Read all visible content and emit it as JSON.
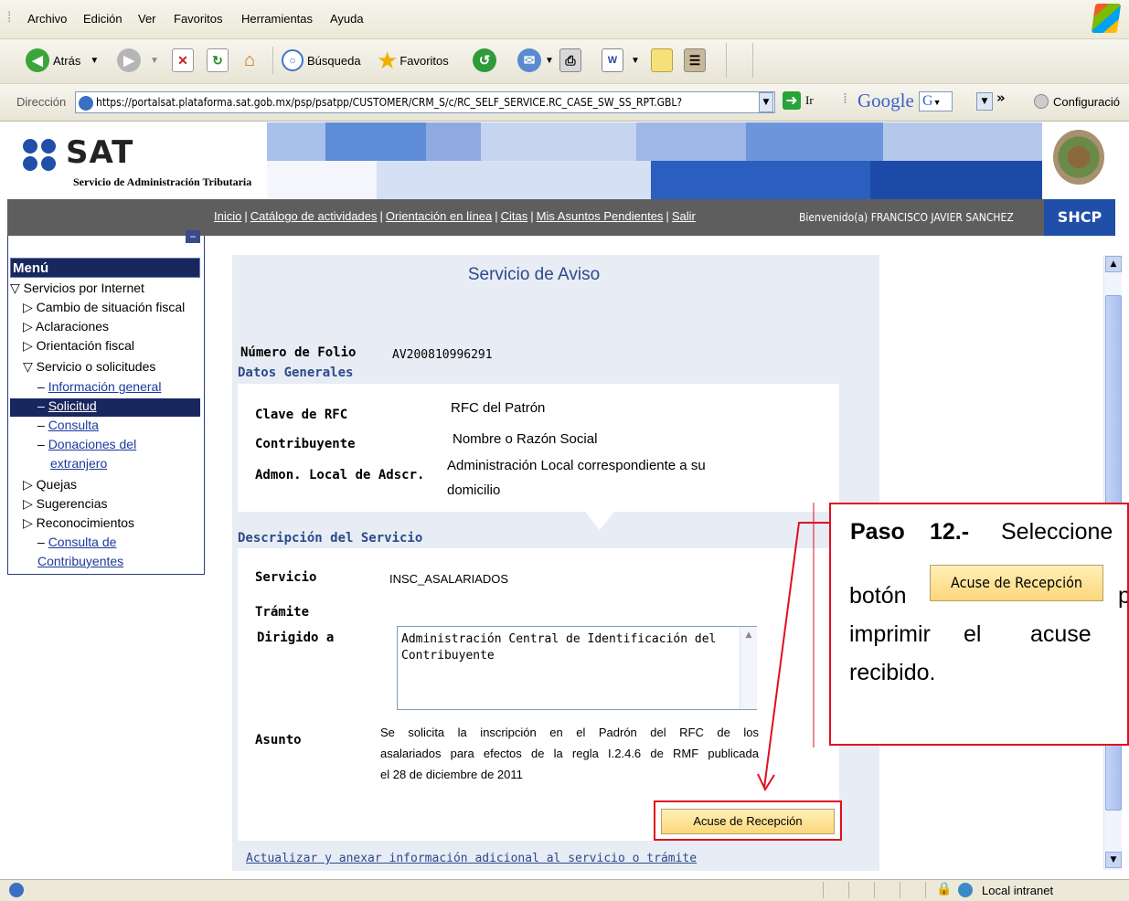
{
  "browser": {
    "menu": [
      "Archivo",
      "Edición",
      "Ver",
      "Favoritos",
      "Herramientas",
      "Ayuda"
    ],
    "toolbar": {
      "back": "Atrás",
      "search": "Búsqueda",
      "favorites": "Favoritos"
    },
    "address_label": "Dirección",
    "url": "https://portalsat.plataforma.sat.gob.mx/psp/psatpp/CUSTOMER/CRM_S/c/RC_SELF_SERVICE.RC_CASE_SW_SS_RPT.GBL?",
    "go_label": "Ir",
    "google_label": "Google",
    "google_g": "G",
    "config_label": "Configuració",
    "status_zone": "Local intranet"
  },
  "header": {
    "logo_text": "SAT",
    "logo_subtitle": "Servicio de Administración Tributaria",
    "nav_links": [
      "Inicio",
      "Catálogo de actividades",
      "Orientación en línea",
      "Citas",
      "Mis Asuntos Pendientes",
      "Salir"
    ],
    "welcome": "Bienvenido(a) FRANCISCO JAVIER SANCHEZ",
    "shcp": "SHCP"
  },
  "menu": {
    "title": "Menú",
    "items": [
      {
        "label": "Servicios por Internet",
        "type": "open"
      },
      {
        "label": "Cambio de situación fiscal",
        "type": "closed"
      },
      {
        "label": "Aclaraciones",
        "type": "closed"
      },
      {
        "label": "Orientación fiscal",
        "type": "closed"
      },
      {
        "label": "Servicio o solicitudes",
        "type": "open"
      },
      {
        "label": "Información general",
        "type": "link"
      },
      {
        "label": "Solicitud",
        "type": "selected"
      },
      {
        "label": "Consulta",
        "type": "link"
      },
      {
        "label": "Donaciones del",
        "type": "link"
      },
      {
        "label": "extranjero",
        "type": "link-cont"
      },
      {
        "label": "Quejas",
        "type": "closed"
      },
      {
        "label": "Sugerencias",
        "type": "closed"
      },
      {
        "label": "Reconocimientos",
        "type": "closed"
      },
      {
        "label": "Consulta de",
        "type": "link"
      },
      {
        "label": "Contribuyentes",
        "type": "link-cont"
      }
    ]
  },
  "form": {
    "title": "Servicio de Aviso",
    "folio_label": "Número de Folio",
    "folio_value": "AV200810996291",
    "section1": "Datos Generales",
    "rfc_label": "Clave de RFC",
    "rfc_value": "RFC del Patrón",
    "contrib_label": "Contribuyente",
    "contrib_value": "Nombre o Razón Social",
    "admon_label": "Admon. Local de Adscr.",
    "admon_value_1": "Administración Local  correspondiente a su",
    "admon_value_2": "domicilio",
    "section2": "Descripción del Servicio",
    "servicio_label": "Servicio",
    "servicio_value": "INSC_ASALARIADOS",
    "tramite_label": "Trámite",
    "dirigido_label": "Dirigido a",
    "dirigido_value": "Administración Central de Identificación del Contribuyente",
    "asunto_label": "Asunto",
    "asunto_lines": [
      "Se solicita la inscripción en el Padrón del RFC de los",
      "asalariados para efectos de la regla I.2.4.6 de RMF publicada",
      "el 28 de diciembre de 2011"
    ],
    "acuse_button": "Acuse de Recepción",
    "update_link": "Actualizar y anexar información adicional al servicio o trámite"
  },
  "callout": {
    "paso": "Paso",
    "step": "12.-",
    "line1_word": "Seleccione",
    "boton": "botón",
    "button_label": "Acuse de Recepción",
    "after_button": "p",
    "line3": [
      "imprimir",
      "el",
      "acuse"
    ],
    "line4": "recibido."
  },
  "colors": {
    "accent_red": "#e01020",
    "nav_gray": "#5e5e5e",
    "menu_navy": "#18285e",
    "sat_blue": "#1f4fa8"
  }
}
